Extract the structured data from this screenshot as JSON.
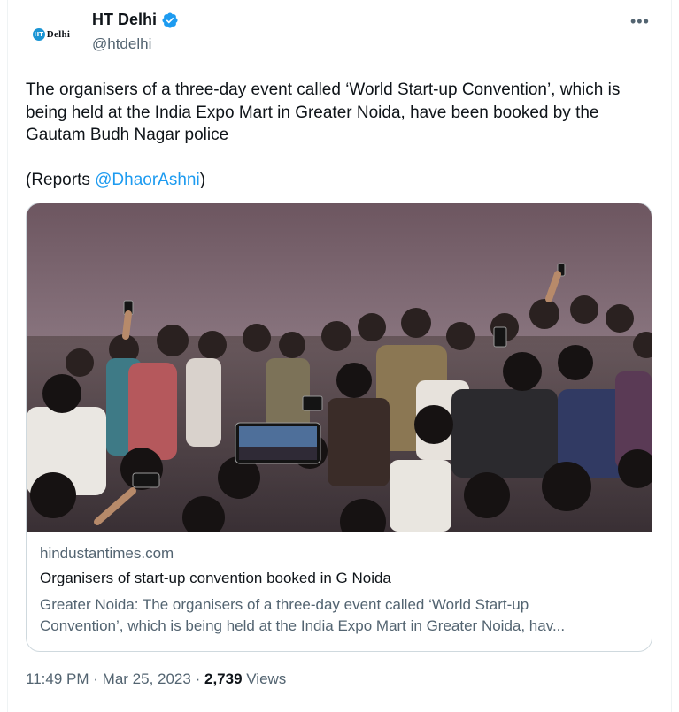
{
  "author": {
    "display_name": "HT Delhi",
    "handle": "@htdelhi",
    "avatar_badge": "HT",
    "avatar_text": "Delhi",
    "verified": true,
    "brand_color": "#1b95d4",
    "verified_color": "#1d9bf0"
  },
  "more_icon": "•••",
  "tweet": {
    "text": "The organisers of a three-day event called ‘World Start-up Convention’, which is being held at the India Expo Mart in Greater Noida, have been booked by the Gautam Budh Nagar police",
    "reports_prefix": "(Reports ",
    "reports_mention": "@DhaorAshni",
    "reports_suffix": ")"
  },
  "link_card": {
    "image_alt": "Crowd of people and police officers on a stage holding up phones",
    "domain": "hindustantimes.com",
    "title": "Organisers of start-up convention booked in G Noida",
    "description_line1": "Greater Noida: The organisers of a three-day event called ‘World Start-up",
    "description_line2": "Convention’, which is being held at the India Expo Mart in Greater Noida, hav..."
  },
  "meta": {
    "time": "11:49 PM",
    "separator": "·",
    "date": "Mar 25, 2023",
    "views_count": "2,739",
    "views_label": "Views"
  }
}
